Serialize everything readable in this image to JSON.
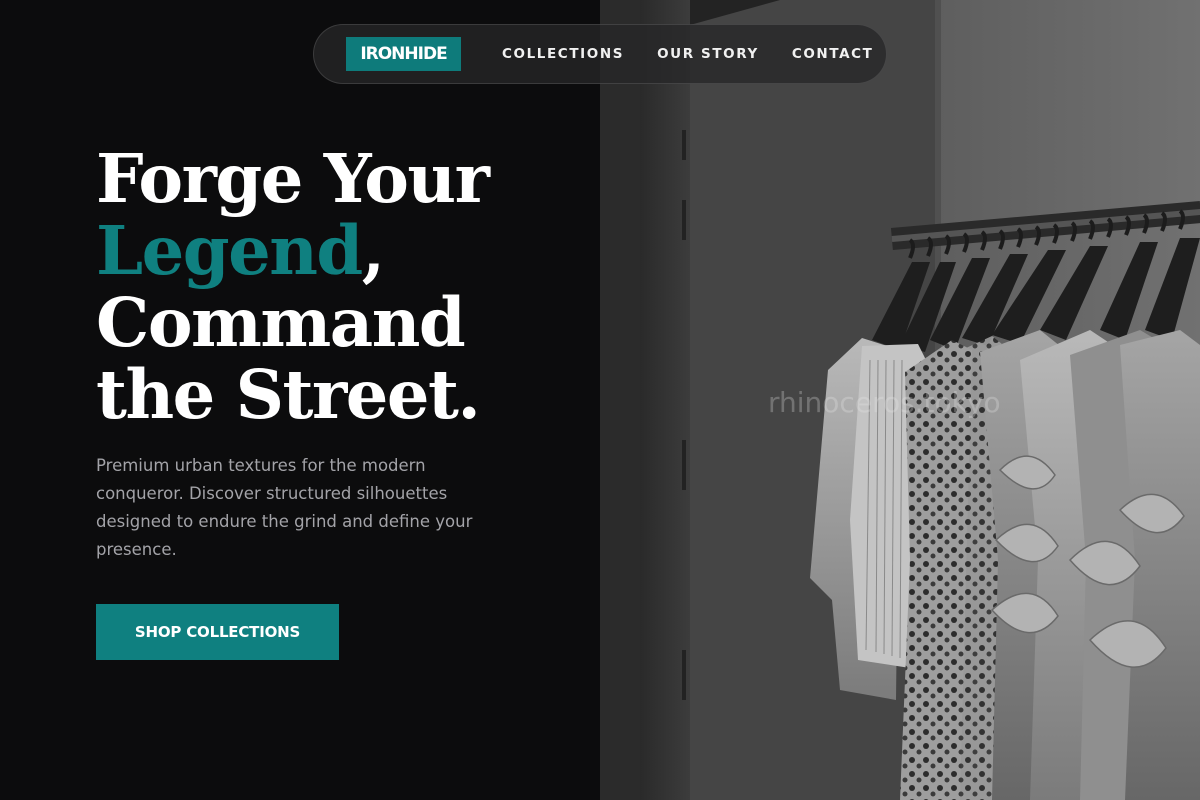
{
  "brand": {
    "logo_text": "IRONHIDE",
    "accent_color": "#0f8080"
  },
  "nav": {
    "links": [
      {
        "label": "COLLECTIONS"
      },
      {
        "label": "OUR STORY"
      },
      {
        "label": "CONTACT"
      }
    ]
  },
  "hero": {
    "headline": {
      "line1": "Forge Your",
      "accent_word": "Legend",
      "accent_suffix": ",",
      "line3": "Command",
      "line4": "the Street."
    },
    "subtitle": "Premium urban textures for the modern conqueror. Discover structured silhouettes designed to endure the grind and define your presence.",
    "cta_label": "SHOP COLLECTIONS"
  },
  "photo": {
    "watermark": "rhinoceros.tokyo",
    "description_icon": "clothing-rack-photo"
  },
  "colors": {
    "background": "#0c0c0d",
    "text_primary": "#ffffff",
    "text_muted": "#a3a3a8",
    "accent": "#0f8080"
  }
}
